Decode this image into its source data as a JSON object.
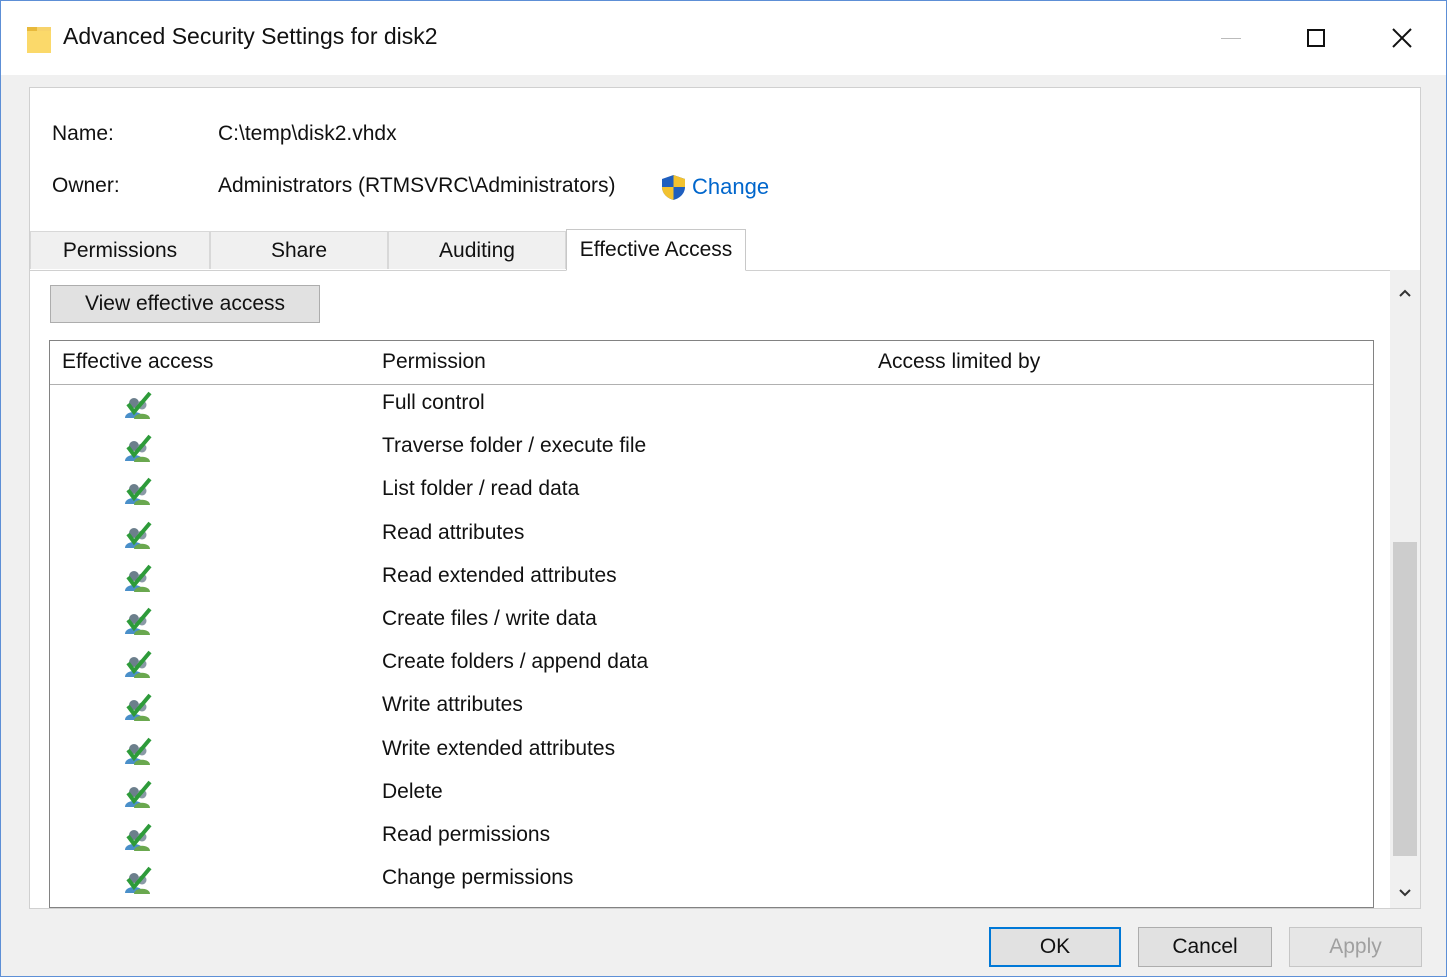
{
  "window": {
    "title": "Advanced Security Settings for disk2",
    "icons": {
      "app": "folder-icon",
      "minimize": "minimize-icon",
      "maximize": "maximize-icon",
      "close": "close-icon"
    }
  },
  "info": {
    "name_label": "Name:",
    "name_value": "C:\\temp\\disk2.vhdx",
    "owner_label": "Owner:",
    "owner_value": "Administrators (RTMSVRC\\Administrators)",
    "change_label": "Change",
    "change_icon": "uac-shield-icon"
  },
  "tabs": [
    {
      "label": "Permissions",
      "active": false
    },
    {
      "label": "Share",
      "active": false
    },
    {
      "label": "Auditing",
      "active": false
    },
    {
      "label": "Effective Access",
      "active": true
    }
  ],
  "effective_access": {
    "view_button": "View effective access",
    "columns": [
      "Effective access",
      "Permission",
      "Access limited by"
    ],
    "row_icon": "allowed-check-icon",
    "rows": [
      {
        "permission": "Full control",
        "access_limited_by": ""
      },
      {
        "permission": "Traverse folder / execute file",
        "access_limited_by": ""
      },
      {
        "permission": "List folder / read data",
        "access_limited_by": ""
      },
      {
        "permission": "Read attributes",
        "access_limited_by": ""
      },
      {
        "permission": "Read extended attributes",
        "access_limited_by": ""
      },
      {
        "permission": "Create files / write data",
        "access_limited_by": ""
      },
      {
        "permission": "Create folders / append data",
        "access_limited_by": ""
      },
      {
        "permission": "Write attributes",
        "access_limited_by": ""
      },
      {
        "permission": "Write extended attributes",
        "access_limited_by": ""
      },
      {
        "permission": "Delete",
        "access_limited_by": ""
      },
      {
        "permission": "Read permissions",
        "access_limited_by": ""
      },
      {
        "permission": "Change permissions",
        "access_limited_by": ""
      }
    ]
  },
  "footer": {
    "ok": "OK",
    "cancel": "Cancel",
    "apply": "Apply",
    "apply_enabled": false
  },
  "colors": {
    "accent": "#0078d7",
    "link": "#0066cc",
    "window_border": "#5d8fd6",
    "check_green": "#2e9b3a"
  }
}
